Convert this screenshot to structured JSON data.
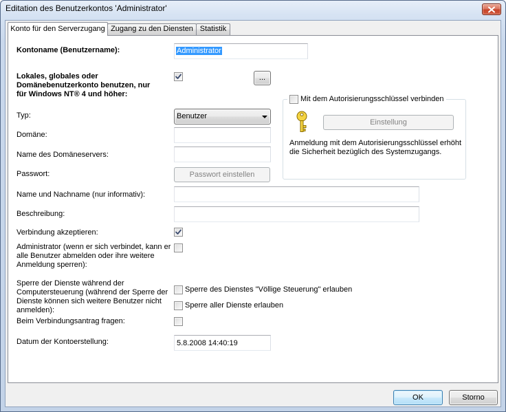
{
  "window": {
    "title": "Editation des Benutzerkontos 'Administrator'",
    "close_icon": "close-icon"
  },
  "tabs": [
    {
      "label": "Konto für den Serverzugang",
      "active": true
    },
    {
      "label": "Zugang zu den Diensten",
      "active": false
    },
    {
      "label": "Statistik",
      "active": false
    }
  ],
  "form": {
    "account_name": {
      "label": "Kontoname (Benutzername):",
      "value": "Administrator",
      "selected": true
    },
    "domain_account": {
      "label_lines": [
        "Lokales, globales oder",
        "Domänebenutzerkonto benutzen, nur",
        "für Windows NT® 4 und höher:"
      ],
      "checked": true,
      "browse_label": "..."
    },
    "auth_key": {
      "label": "Mit dem Autorisierungsschlüssel verbinden",
      "checked": false,
      "icon": "key-icon",
      "settings_label": "Einstellung",
      "settings_enabled": false,
      "description_lines": [
        "Anmeldung mit dem Autorisierungsschlüssel erhöht",
        "die Sicherheit bezüglich des Systemzugangs."
      ]
    },
    "type": {
      "label": "Typ:",
      "value": "Benutzer",
      "dropdown_icon": "chevron-down-icon"
    },
    "domain": {
      "label": "Domäne:",
      "value": ""
    },
    "domain_server": {
      "label": "Name des Domäneservers:",
      "value": ""
    },
    "password": {
      "label": "Passwort:",
      "button_label": "Passwort einstellen",
      "button_enabled": false
    },
    "full_name": {
      "label": "Name und Nachname (nur informativ):",
      "value": ""
    },
    "description": {
      "label": "Beschreibung:",
      "value": ""
    },
    "accept_connection": {
      "label": "Verbindung akzeptieren:",
      "checked": true
    },
    "administrator": {
      "label_lines": [
        "Administrator (wenn er sich verbindet, kann er",
        "alle Benutzer abmelden oder ihre weitere",
        "Anmeldung sperren):"
      ],
      "checked": false
    },
    "service_lock": {
      "label_lines": [
        "Sperre der Dienste während der",
        "Computersteuerung (während der Sperre der",
        "Dienste können sich weitere Benutzer nicht",
        "anmelden):"
      ],
      "options": [
        {
          "label": "Sperre des Dienstes \"Völlige Steuerung\" erlauben",
          "checked": false
        },
        {
          "label": "Sperre aller Dienste erlauben",
          "checked": false
        }
      ]
    },
    "ask_on_connect": {
      "label": "Beim Verbindungsantrag fragen:",
      "checked": false
    },
    "created": {
      "label": "Datum der Kontoerstellung:",
      "value": "5.8.2008 14:40:19"
    }
  },
  "footer": {
    "ok_label": "OK",
    "cancel_label": "Storno"
  },
  "colors": {
    "selection": "#3399ff",
    "checkmark": "#3b4b6f",
    "focus_border": "#3c7fb1",
    "close_button": "#c7452a",
    "key_fill": "#f5d442"
  }
}
